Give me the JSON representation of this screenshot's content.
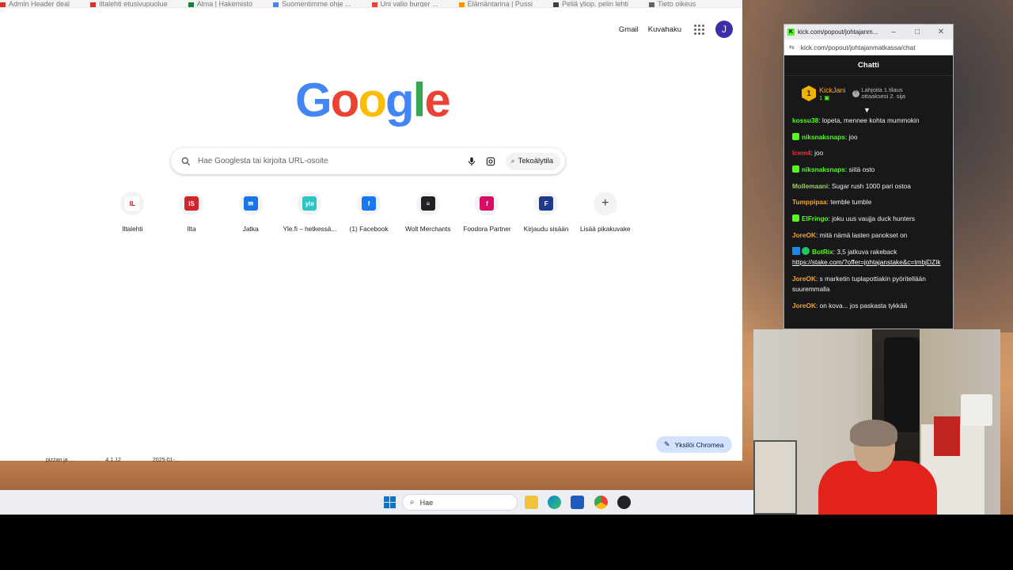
{
  "browser": {
    "bookmarks": [
      "Admin Header deal",
      "Iltalehti etusivupuolue",
      "Alma | Hakemisto",
      "Suomentimme ohje ...",
      "Uni valio burger ...",
      "Elämäntarina | Pussi",
      "Peliä yliop. pelin lehti",
      "Tieto oikeus"
    ],
    "top_links": {
      "gmail": "Gmail",
      "images": "Kuvahaku"
    },
    "avatar_letter": "J",
    "logo_letters": [
      {
        "ch": "G",
        "color": "#4285f4"
      },
      {
        "ch": "o",
        "color": "#ea4335"
      },
      {
        "ch": "o",
        "color": "#fbbc05"
      },
      {
        "ch": "g",
        "color": "#4285f4"
      },
      {
        "ch": "l",
        "color": "#34a853"
      },
      {
        "ch": "e",
        "color": "#ea4335"
      }
    ],
    "search": {
      "placeholder": "Hae Googlesta tai kirjoita URL-osoite",
      "ai_mode": "Tekoälytila"
    },
    "shortcuts": [
      {
        "label": "Iltalehti",
        "fav": "IL",
        "bg": "#ffffff",
        "fg": "#c00000"
      },
      {
        "label": "Ilta",
        "fav": "IS",
        "bg": "#d3232d",
        "fg": "#ffffff"
      },
      {
        "label": "Jatka",
        "fav": "✉",
        "bg": "#1a73e8",
        "fg": "#ffffff"
      },
      {
        "label": "Yle.fi – hetkessä...",
        "fav": "yle",
        "bg": "#2ec4c4",
        "fg": "#ffffff"
      },
      {
        "label": "(1) Facebook",
        "fav": "f",
        "bg": "#1877f2",
        "fg": "#ffffff"
      },
      {
        "label": "Wolt Merchants",
        "fav": "≡",
        "bg": "#202124",
        "fg": "#ffffff"
      },
      {
        "label": "Foodora Partner",
        "fav": "f",
        "bg": "#d70f64",
        "fg": "#ffffff"
      },
      {
        "label": "Kirjaudu sisään",
        "fav": "F",
        "bg": "#1e3a8a",
        "fg": "#ffffff"
      },
      {
        "label": "Lisää pikakuvake",
        "fav": "+",
        "bg": "#f1f3f4",
        "fg": "#3c4043"
      }
    ],
    "customize_label": "Yksilöi Chromea"
  },
  "desktop_items": [
    "pizzan ja ...",
    "4.1.12",
    "2025-01-..."
  ],
  "taskbar": {
    "search_placeholder": "Hae"
  },
  "chat": {
    "window_title": "kick.com/popout/johtajanm...",
    "url": "kick.com/popout/johtajanmatkassa/chat",
    "header": "Chatti",
    "pinned": {
      "rank": "1",
      "user": "KickJani",
      "sub_count": "1",
      "note": "Lahjoita 1 tilaus ottaaksesi 2. sija"
    },
    "messages": [
      {
        "user": "kossu38",
        "color": "#53fc18",
        "mod": false,
        "text": "lopeta, mennee kohta mummokin"
      },
      {
        "user": "niksnaksnaps",
        "color": "#53fc18",
        "mod": true,
        "text": "joo"
      },
      {
        "user": "Icem4",
        "color": "#e53935",
        "mod": false,
        "text": "joo"
      },
      {
        "user": "niksnaksnaps",
        "color": "#53fc18",
        "mod": true,
        "text": "siitä osto"
      },
      {
        "user": "Mollemaani",
        "color": "#9ccc65",
        "mod": false,
        "text": "Sugar rush 1000 pari ostoa"
      },
      {
        "user": "Tumppipaa",
        "color": "#f5a623",
        "mod": false,
        "text": "temble tumble"
      },
      {
        "user": "ElFringo",
        "color": "#53fc18",
        "mod": true,
        "text": "joku uus vaujja duck hunters"
      },
      {
        "user": "JoreOK",
        "color": "#f5a623",
        "mod": false,
        "text": "mitä nämä lasten panokset on"
      },
      {
        "user": "BotRix",
        "color": "#53fc18",
        "mod": false,
        "bot": true,
        "text": "3,5 jatkuva rakeback",
        "link": "https://stake.com/?offer=johtajanstake&c=tmbjDZIk"
      },
      {
        "user": "JoreOK",
        "color": "#f5a623",
        "mod": false,
        "text": "s marketin tuplapottiakin pyöritellään suuremmalla"
      },
      {
        "user": "JoreOK",
        "color": "#f5a623",
        "mod": false,
        "text": "on kova... jos paskasta tykkää"
      }
    ]
  }
}
